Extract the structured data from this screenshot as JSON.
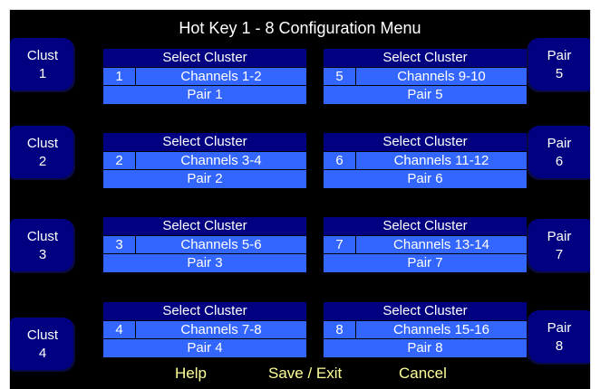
{
  "title": "Hot Key 1 - 8 Configuration Menu",
  "left_buttons": [
    {
      "label": "Clust",
      "num": "1"
    },
    {
      "label": "Clust",
      "num": "2"
    },
    {
      "label": "Clust",
      "num": "3"
    },
    {
      "label": "Clust",
      "num": "4"
    }
  ],
  "right_buttons": [
    {
      "label": "Pair",
      "num": "5"
    },
    {
      "label": "Pair",
      "num": "6"
    },
    {
      "label": "Pair",
      "num": "7"
    },
    {
      "label": "Pair",
      "num": "8"
    }
  ],
  "panels": [
    {
      "header": "Select Cluster",
      "number": "1",
      "channels": "Channels 1-2",
      "pair": "Pair 1"
    },
    {
      "header": "Select Cluster",
      "number": "2",
      "channels": "Channels 3-4",
      "pair": "Pair 2"
    },
    {
      "header": "Select Cluster",
      "number": "3",
      "channels": "Channels 5-6",
      "pair": "Pair 3"
    },
    {
      "header": "Select Cluster",
      "number": "4",
      "channels": "Channels 7-8",
      "pair": "Pair 4"
    },
    {
      "header": "Select Cluster",
      "number": "5",
      "channels": "Channels 9-10",
      "pair": "Pair 5"
    },
    {
      "header": "Select Cluster",
      "number": "6",
      "channels": "Channels 11-12",
      "pair": "Pair 6"
    },
    {
      "header": "Select Cluster",
      "number": "7",
      "channels": "Channels 13-14",
      "pair": "Pair 7"
    },
    {
      "header": "Select Cluster",
      "number": "8",
      "channels": "Channels 15-16",
      "pair": "Pair 8"
    }
  ],
  "footer": {
    "help": "Help",
    "save_exit": "Save / Exit",
    "cancel": "Cancel"
  },
  "colors": {
    "background": "#000000",
    "button_navy": "#000080",
    "field_blue": "#3366ff",
    "footer_text": "#ffff99"
  }
}
